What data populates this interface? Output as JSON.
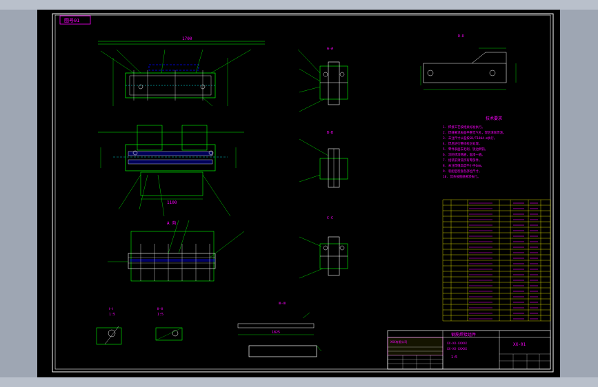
{
  "drawing": {
    "title_tag": "图号01",
    "company": "XXX有限公司",
    "drawing_title": "钢筋焊接组件",
    "drawing_code": "XX-01",
    "spec_line_1": "XX-XX-XXXXX",
    "spec_line_2": "XX-XX-XXXXX",
    "scale": "1:5",
    "view_a_label": "A-A",
    "view_b_label": "B-B",
    "view_c_label": "C-C",
    "view_d_label": "D-D",
    "detail_scale": "1:5",
    "detail_1_label": "Ⅰ-Ⅰ",
    "detail_2_label": "Ⅱ-Ⅱ",
    "detail_3_label": "Ⅲ-Ⅲ",
    "plan_label": "A 向",
    "dim_top_width": "1700",
    "dim_plan_width": "1100",
    "dim_bar_length": "1825"
  },
  "notes": {
    "heading": "技术要求",
    "items": [
      "1. 焊接工艺按相关标准执行。",
      "2. 焊缝要求表面平整无气孔，焊后清除焊渣。",
      "3. 未注尺寸公差按GB/T1804-m执行。",
      "4. 焊后进行整体校正处理。",
      "5. 零件表面去毛刺，锐边倒钝。",
      "6. 涂防锈漆两遍，面漆一遍。",
      "7. 组装前清洗所有零部件。",
      "8. 未注焊缝高度不小于6mm。",
      "9. 装配后检查各部位尺寸。",
      "10. 其余按图纸要求执行。"
    ]
  },
  "parts_table": {
    "rows": 22
  },
  "colors": {
    "line": "#00ff00",
    "text": "#ff00ff",
    "hatch": "#ffffff",
    "dim": "#00ffff",
    "highlight": "#ffff00",
    "accent": "#0000ff"
  }
}
